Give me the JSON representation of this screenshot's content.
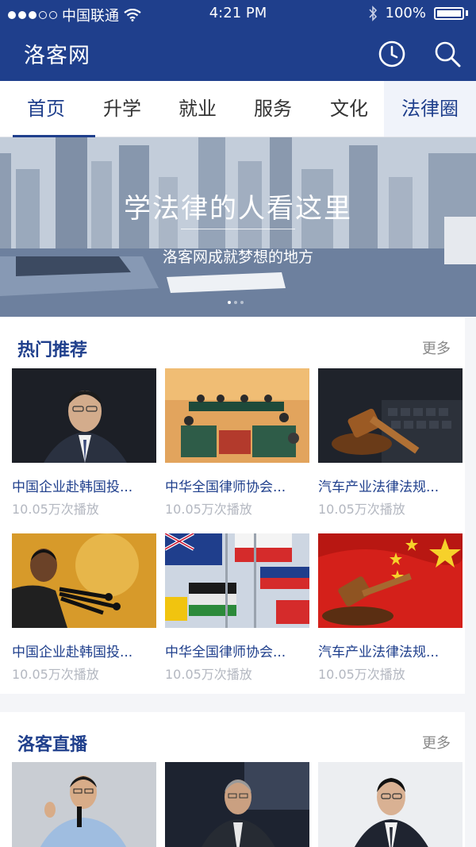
{
  "status_bar": {
    "carrier": "中国联通",
    "time": "4:21 PM",
    "battery": "100%"
  },
  "header": {
    "title": "洛客网",
    "history_icon": "clock-icon",
    "search_icon": "search-icon"
  },
  "tabs": [
    "首页",
    "升学",
    "就业",
    "服务",
    "文化",
    "法律圈"
  ],
  "banner": {
    "title": "学法律的人看这里",
    "subtitle": "洛客网成就梦想的地方"
  },
  "hot": {
    "title": "热门推荐",
    "more": "更多",
    "items": [
      {
        "title": "中国企业赴韩国投...",
        "plays": "10.05万次播放"
      },
      {
        "title": "中华全国律师协会...",
        "plays": "10.05万次播放"
      },
      {
        "title": "汽车产业法律法规...",
        "plays": "10.05万次播放"
      },
      {
        "title": "中国企业赴韩国投...",
        "plays": "10.05万次播放"
      },
      {
        "title": "中华全国律师协会...",
        "plays": "10.05万次播放"
      },
      {
        "title": "汽车产业法律法规...",
        "plays": "10.05万次播放"
      }
    ]
  },
  "live": {
    "title": "洛客直播",
    "more": "更多"
  },
  "colors": {
    "brand": "#1f3f8c",
    "muted": "#b3b7c0"
  }
}
